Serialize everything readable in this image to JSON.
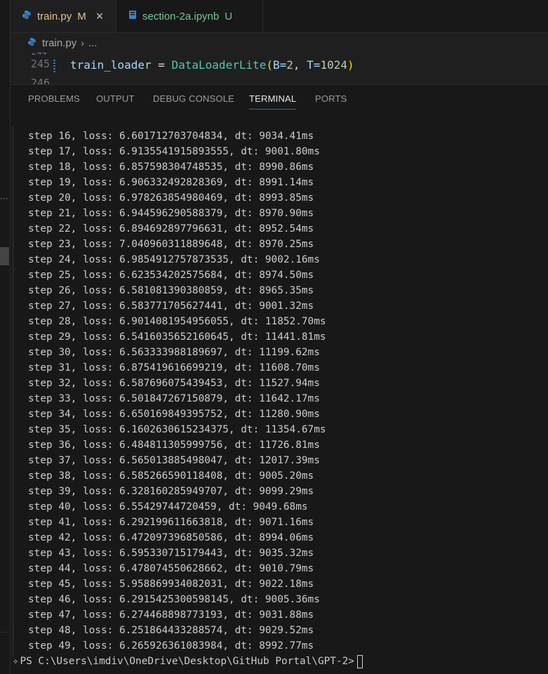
{
  "tabs": [
    {
      "label": "train.py",
      "marker": "M",
      "close": "×",
      "icon": "python-icon"
    },
    {
      "label": "section-2a.ipynb",
      "marker": "U",
      "icon": "notebook-icon"
    }
  ],
  "breadcrumb": {
    "file": "train.py",
    "rest": "..."
  },
  "editor": {
    "line_faded_top": "244",
    "line_number": "245",
    "line_faded_bottom": "246",
    "code": {
      "var": "train_loader",
      "op": " = ",
      "cls": "DataLoaderLite",
      "open": "(",
      "arg1": "B=",
      "v1": "2",
      "sep": ", ",
      "arg2": "T=",
      "v2": "1024",
      "close": ")"
    }
  },
  "panel_tabs": [
    "PROBLEMS",
    "OUTPUT",
    "DEBUG CONSOLE",
    "TERMINAL",
    "PORTS"
  ],
  "terminal": {
    "lines": [
      "step 16, loss: 6.601712703704834, dt: 9034.41ms",
      "step 17, loss: 6.9135541915893555, dt: 9001.80ms",
      "step 18, loss: 6.857598304748535, dt: 8990.86ms",
      "step 19, loss: 6.906332492828369, dt: 8991.14ms",
      "step 20, loss: 6.978263854980469, dt: 8993.85ms",
      "step 21, loss: 6.944596290588379, dt: 8970.90ms",
      "step 22, loss: 6.894692897796631, dt: 8952.54ms",
      "step 23, loss: 7.040960311889648, dt: 8970.25ms",
      "step 24, loss: 6.9854912757873535, dt: 9002.16ms",
      "step 25, loss: 6.623534202575684, dt: 8974.50ms",
      "step 26, loss: 6.581081390380859, dt: 8965.35ms",
      "step 27, loss: 6.583771705627441, dt: 9001.32ms",
      "step 28, loss: 6.9014081954956055, dt: 11852.70ms",
      "step 29, loss: 6.5416035652160645, dt: 11441.81ms",
      "step 30, loss: 6.563333988189697, dt: 11199.62ms",
      "step 31, loss: 6.875419616699219, dt: 11608.70ms",
      "step 32, loss: 6.587696075439453, dt: 11527.94ms",
      "step 33, loss: 6.501847267150879, dt: 11642.17ms",
      "step 34, loss: 6.650169849395752, dt: 11280.90ms",
      "step 35, loss: 6.1602630615234375, dt: 11354.67ms",
      "step 36, loss: 6.484811305999756, dt: 11726.81ms",
      "step 37, loss: 6.565013885498047, dt: 12017.39ms",
      "step 38, loss: 6.585266590118408, dt: 9005.20ms",
      "step 39, loss: 6.328160285949707, dt: 9099.29ms",
      "step 40, loss: 6.55429744720459, dt: 9049.68ms",
      "step 41, loss: 6.292199611663818, dt: 9071.16ms",
      "step 42, loss: 6.472097396850586, dt: 8994.06ms",
      "step 43, loss: 6.595330715179443, dt: 9035.32ms",
      "step 44, loss: 6.478074550628662, dt: 9010.79ms",
      "step 45, loss: 5.958869934082031, dt: 9022.18ms",
      "step 46, loss: 6.2915425300598145, dt: 9005.36ms",
      "step 47, loss: 6.274468898773193, dt: 9031.88ms",
      "step 48, loss: 6.251864433288574, dt: 9029.52ms",
      "step 49, loss: 6.265926361083984, dt: 8992.77ms"
    ],
    "prompt": "PS C:\\Users\\imdiv\\OneDrive\\Desktop\\GitHub Portal\\GPT-2>"
  },
  "colors": {
    "accent": "#0078d4",
    "modified": "#e2c08d",
    "untracked": "#73c991"
  }
}
